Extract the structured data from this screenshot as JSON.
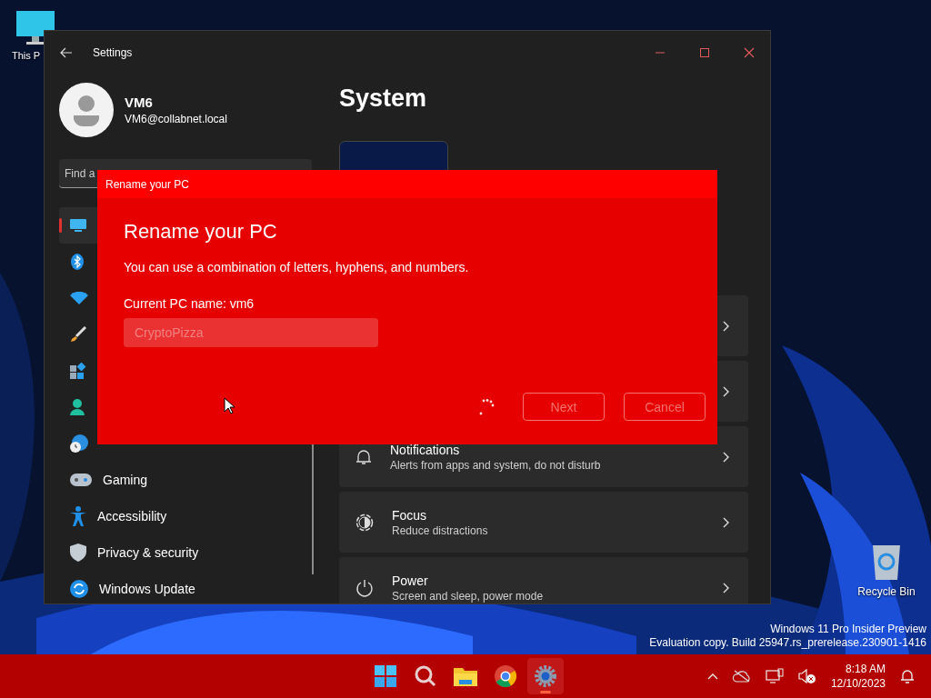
{
  "desktop": {
    "icons": [
      {
        "label": "This P"
      },
      {
        "label": "Recycle Bin"
      }
    ],
    "watermark": [
      "Windows 11 Pro Insider Preview",
      "Evaluation copy. Build 25947.rs_prerelease.230901-1416"
    ]
  },
  "settings_window": {
    "title": "Settings",
    "account": {
      "name": "VM6",
      "email": "VM6@collabnet.local"
    },
    "search": {
      "placeholder": "Find a"
    },
    "sidebar": {
      "items": [
        {
          "selected": true
        },
        {
          "selected": false
        },
        {
          "selected": false
        },
        {
          "selected": false
        },
        {
          "selected": false
        },
        {
          "selected": false
        },
        {
          "selected": false
        },
        {
          "label": "Gaming",
          "selected": false
        },
        {
          "label": "Accessibility",
          "selected": false
        },
        {
          "label": "Privacy & security",
          "selected": false
        },
        {
          "label": "Windows Update",
          "selected": false
        }
      ]
    },
    "page_title": "System",
    "cards": [
      {
        "kind": "covered"
      },
      {
        "kind": "covered"
      },
      {
        "kind": "item",
        "title": "Notifications",
        "subtitle": "Alerts from apps and system, do not disturb"
      },
      {
        "kind": "item",
        "title": "Focus",
        "subtitle": "Reduce distractions"
      },
      {
        "kind": "item",
        "title": "Power",
        "subtitle": "Screen and sleep, power mode"
      }
    ]
  },
  "dialog": {
    "title": "Rename your PC",
    "heading": "Rename your PC",
    "description": "You can use a combination of letters, hyphens, and numbers.",
    "current_name": "Current PC name: vm6",
    "input": {
      "value": "CryptoPizza",
      "disabled": true
    },
    "busy": true,
    "buttons": [
      {
        "label": "Next",
        "disabled": true
      },
      {
        "label": "Cancel",
        "disabled": true
      }
    ]
  },
  "taskbar": {
    "apps": [
      {
        "selected": false
      },
      {
        "selected": false
      },
      {
        "selected": false
      },
      {
        "selected": false
      },
      {
        "selected": true
      }
    ],
    "time": "8:18 AM",
    "date": "12/10/2023"
  }
}
